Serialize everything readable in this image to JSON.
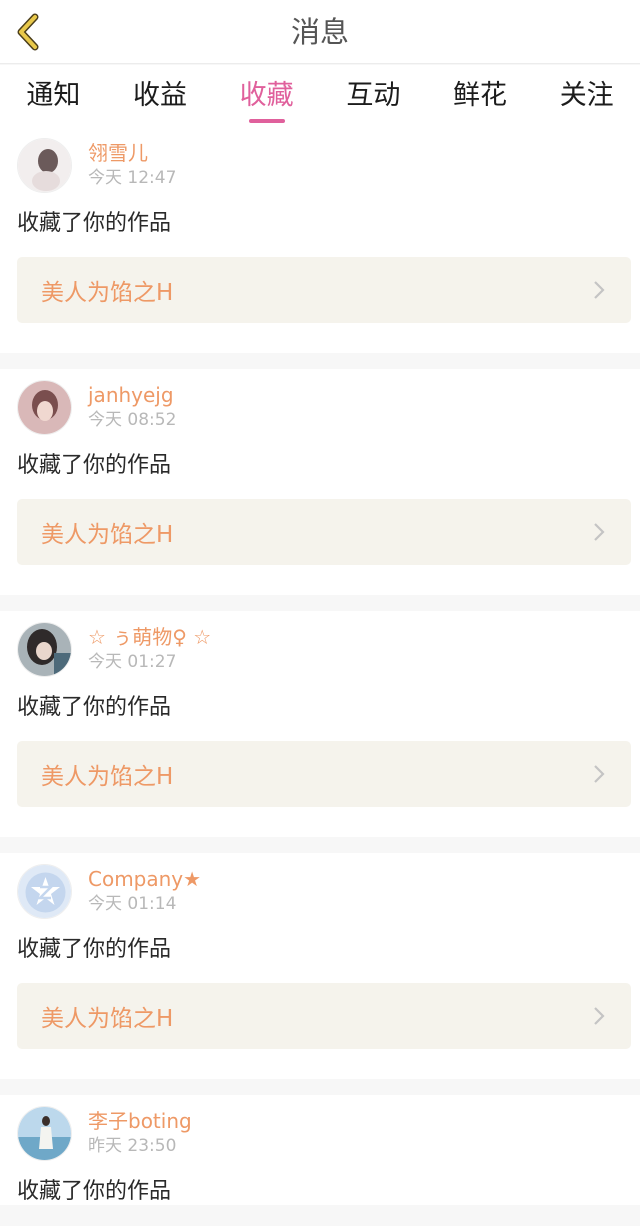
{
  "header": {
    "title": "消息",
    "back_icon": "chevron-left-icon",
    "back_color": "#e8c84a"
  },
  "tabs": [
    {
      "label": "通知",
      "active": false
    },
    {
      "label": "收益",
      "active": false
    },
    {
      "label": "收藏",
      "active": true
    },
    {
      "label": "互动",
      "active": false
    },
    {
      "label": "鲜花",
      "active": false
    },
    {
      "label": "关注",
      "active": false
    }
  ],
  "colors": {
    "accent": "#e0609c",
    "username": "#ee9966",
    "card_bg": "#f5f3ec"
  },
  "messages": [
    {
      "username": "翎雪儿",
      "time": "今天 12:47",
      "action": "收藏了你的作品",
      "work_title": "美人为馅之H"
    },
    {
      "username": "janhyejg",
      "time": "今天 08:52",
      "action": "收藏了你的作品",
      "work_title": "美人为馅之H"
    },
    {
      "username": "☆ ぅ萌物♀ ☆",
      "time": "今天 01:27",
      "action": "收藏了你的作品",
      "work_title": "美人为馅之H"
    },
    {
      "username": "Company★",
      "time": "今天 01:14",
      "action": "收藏了你的作品",
      "work_title": "美人为馅之H"
    },
    {
      "username": "李子boting",
      "time": "昨天 23:50",
      "action": "收藏了你的作品"
    }
  ]
}
